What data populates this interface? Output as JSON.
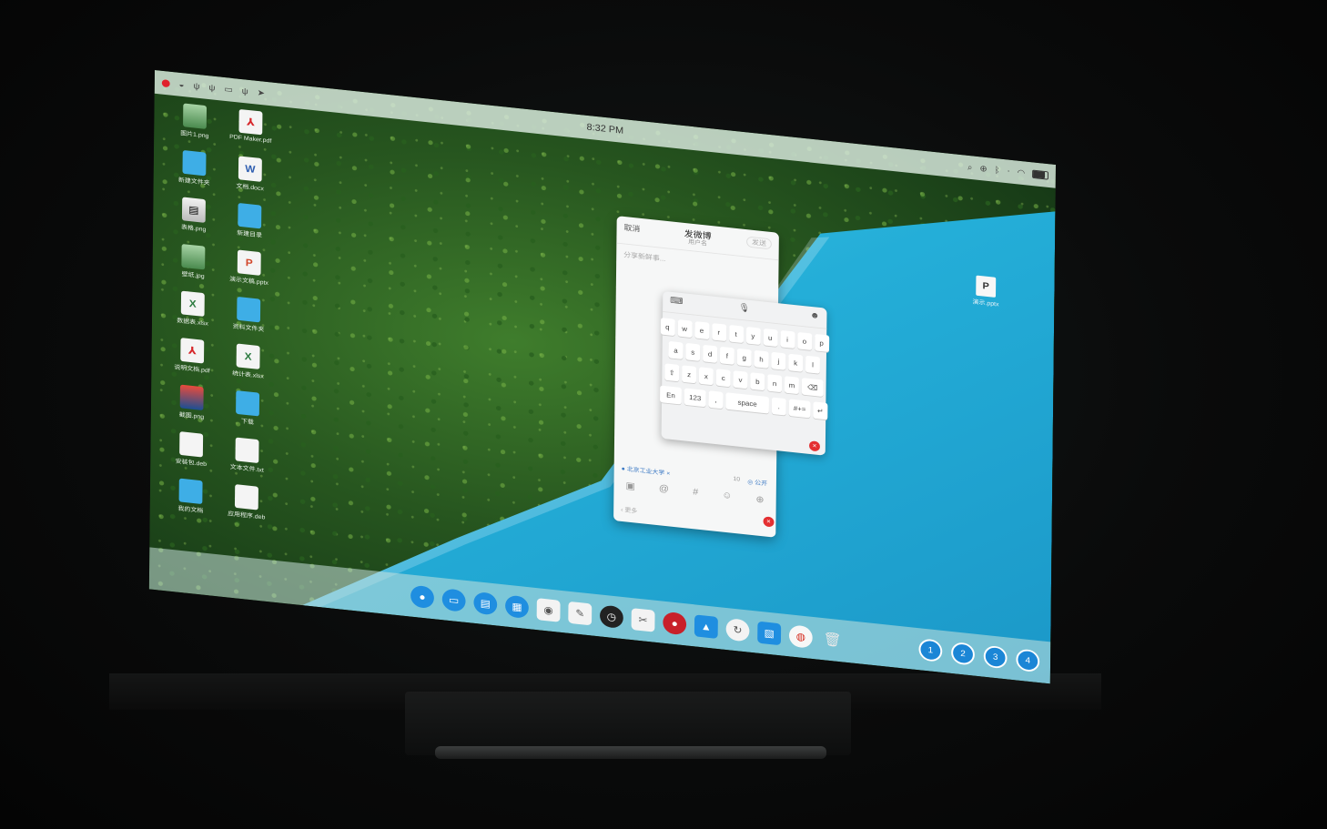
{
  "top_bar": {
    "left_icons": [
      "record-icon",
      "wechat-icon",
      "usb-icon",
      "usb-icon",
      "display-icon",
      "usb-icon",
      "location-icon"
    ],
    "clock": "8:32 PM",
    "right_icons": [
      "search-icon",
      "zoom-icon",
      "bluetooth-icon",
      "network-icon",
      "wifi-icon",
      "battery-icon"
    ]
  },
  "desktop": {
    "icons": [
      {
        "name": "图片1.png",
        "type": "img"
      },
      {
        "name": "PDF Maker.pdf",
        "type": "pdf"
      },
      {
        "name": "新建文件夹",
        "type": "folder"
      },
      {
        "name": "文档.docx",
        "type": "word"
      },
      {
        "name": "表格.png",
        "type": "pic"
      },
      {
        "name": "新建目录",
        "type": "folder"
      },
      {
        "name": "壁纸.jpg",
        "type": "img"
      },
      {
        "name": "演示文稿.pptx",
        "type": "ppt"
      },
      {
        "name": "数据表.xlsx",
        "type": "excel"
      },
      {
        "name": "资料文件夹",
        "type": "folder"
      },
      {
        "name": "说明文档.pdf",
        "type": "pdf"
      },
      {
        "name": "统计表.xlsx",
        "type": "excel"
      },
      {
        "name": "截图.png",
        "type": "img2"
      },
      {
        "name": "下载",
        "type": "folder"
      },
      {
        "name": "安装包.deb",
        "type": "doc"
      },
      {
        "name": "文本文件.txt",
        "type": "doc"
      },
      {
        "name": "我的文档",
        "type": "folder"
      },
      {
        "name": "应用程序.deb",
        "type": "doc"
      }
    ],
    "right_file": {
      "glyph": "P",
      "name": "演示.pptx"
    }
  },
  "dialog": {
    "cancel": "取消",
    "title": "发微博",
    "subtitle": "用户名",
    "send": "发送",
    "placeholder": "分享新鲜事...",
    "location": "北京工业大学",
    "count": "10",
    "visibility": "公开",
    "footer": "更多",
    "tools": [
      "image-icon",
      "at-icon",
      "hashtag-icon",
      "emoji-icon",
      "plus-icon"
    ]
  },
  "keyboard": {
    "row1": [
      "q",
      "w",
      "e",
      "r",
      "t",
      "y",
      "u",
      "i",
      "o",
      "p"
    ],
    "row2": [
      "a",
      "s",
      "d",
      "f",
      "g",
      "h",
      "j",
      "k",
      "l"
    ],
    "row3": [
      "z",
      "x",
      "c",
      "v",
      "b",
      "n",
      "m"
    ],
    "lang": "En",
    "num": "123",
    "comma": ",",
    "space": "space",
    "period": ".",
    "sym": "#+="
  },
  "dock": {
    "apps": [
      "launcher-icon",
      "multitask-icon",
      "file-manager-icon",
      "app-store-icon",
      "browser-icon",
      "notes-icon",
      "clock-icon",
      "screenshot-icon",
      "music-icon",
      "gallery-icon",
      "update-icon",
      "document-viewer-icon",
      "weibo-icon",
      "trash-icon"
    ],
    "workspaces": [
      "1",
      "2",
      "3",
      "4"
    ]
  }
}
